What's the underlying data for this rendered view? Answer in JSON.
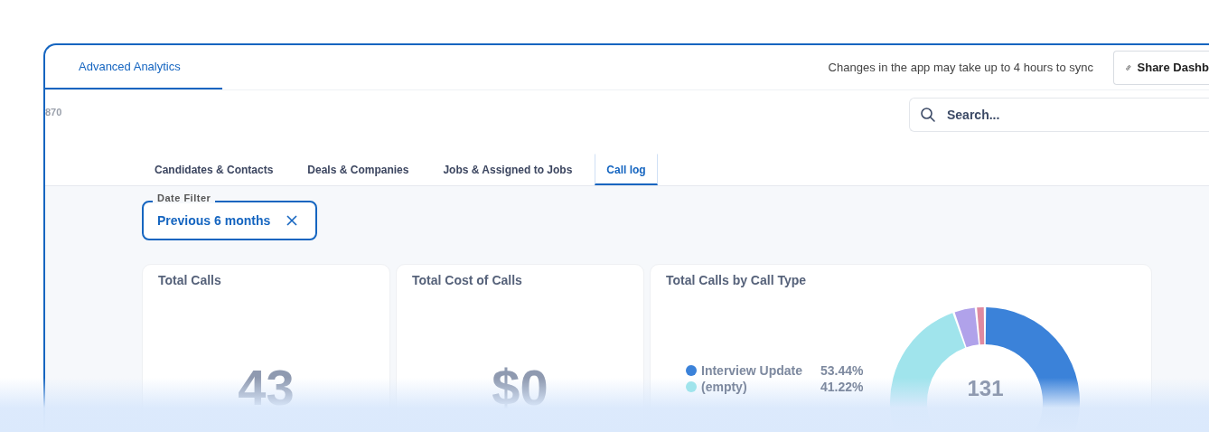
{
  "header": {
    "tabs": [
      {
        "label": "Advanced Analytics",
        "selected": true
      }
    ],
    "sync_note": "Changes in the app may take up to 4 hours to sync",
    "share_button": "Share Dashb"
  },
  "id_label": "870",
  "search": {
    "placeholder": "Search..."
  },
  "section_tabs": [
    {
      "label": "Candidates & Contacts",
      "selected": false
    },
    {
      "label": "Deals & Companies",
      "selected": false
    },
    {
      "label": "Jobs & Assigned to Jobs",
      "selected": false
    },
    {
      "label": "Call log",
      "selected": true
    }
  ],
  "date_filter": {
    "label": "Date Filter",
    "value": "Previous 6 months"
  },
  "stat_cards": [
    {
      "title": "Total Calls",
      "value": "43"
    },
    {
      "title": "Total Cost of Calls",
      "value": "$0"
    }
  ],
  "call_type_card": {
    "title": "Total Calls by Call Type",
    "total": "131",
    "legend": [
      {
        "label": "Interview Update",
        "percent": "53.44%",
        "color": "#3b82d9"
      },
      {
        "label": "(empty)",
        "percent": "41.22%",
        "color": "#a0e4ec"
      }
    ],
    "slices": [
      {
        "color": "#3b82d9"
      },
      {
        "color": "#a0e4ec"
      },
      {
        "color": "#b0a2ea"
      },
      {
        "color": "#e08aa0"
      }
    ],
    "chart_data": {
      "type": "donut",
      "values": [
        53.44,
        41.22,
        3.82,
        1.53
      ]
    }
  }
}
